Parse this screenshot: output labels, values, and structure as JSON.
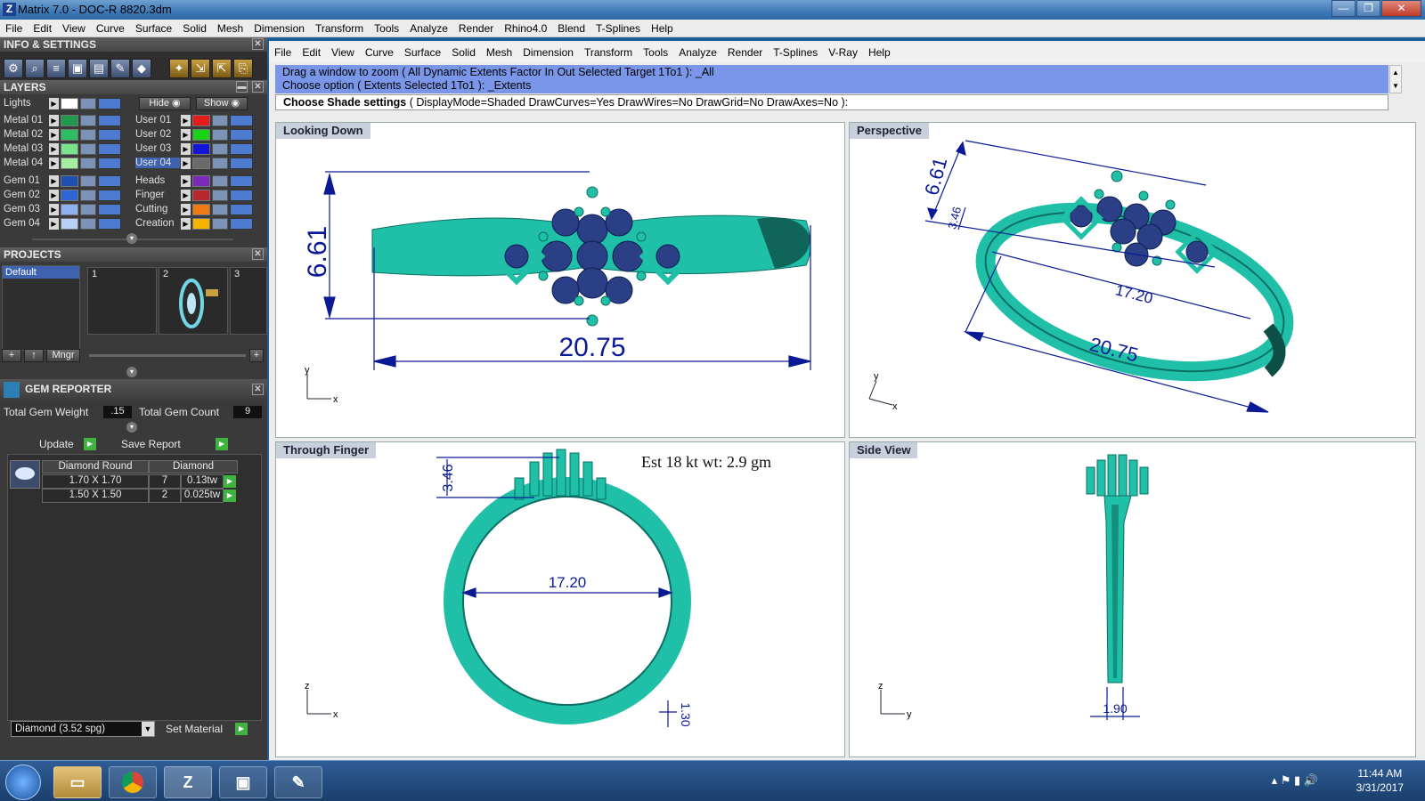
{
  "window": {
    "title": "Matrix 7.0 - DOC-R 8820.3dm",
    "controls": [
      "—",
      "❐",
      "✕"
    ]
  },
  "top_menu": [
    "File",
    "Edit",
    "View",
    "Curve",
    "Surface",
    "Solid",
    "Mesh",
    "Dimension",
    "Transform",
    "Tools",
    "Analyze",
    "Render",
    "Rhino4.0",
    "Blend",
    "T-Splines",
    "Help"
  ],
  "info_settings": {
    "title": "INFO & SETTINGS"
  },
  "layers": {
    "title": "LAYERS",
    "lights_label": "Lights",
    "hide_label": "Hide",
    "show_label": "Show",
    "left": [
      {
        "name": "Metal 01",
        "color": "#1f9a4c"
      },
      {
        "name": "Metal 02",
        "color": "#2dbd62"
      },
      {
        "name": "Metal 03",
        "color": "#79e38b"
      },
      {
        "name": "Metal 04",
        "color": "#a6ee9f"
      },
      {
        "name": "Gem 01",
        "color": "#1e4fb0"
      },
      {
        "name": "Gem 02",
        "color": "#2f66d6"
      },
      {
        "name": "Gem 03",
        "color": "#8db0ef"
      },
      {
        "name": "Gem 04",
        "color": "#b8cff6"
      }
    ],
    "right": [
      {
        "name": "User 01",
        "color": "#e61b1b"
      },
      {
        "name": "User 02",
        "color": "#19d319"
      },
      {
        "name": "User 03",
        "color": "#1414d8"
      },
      {
        "name": "User 04",
        "color": "#6a6a6a"
      },
      {
        "name": "Heads",
        "color": "#7a2ab8"
      },
      {
        "name": "Finger",
        "color": "#b8262e"
      },
      {
        "name": "Cutting",
        "color": "#f07a14"
      },
      {
        "name": "Creation",
        "color": "#f4b400"
      }
    ]
  },
  "projects": {
    "title": "PROJECTS",
    "list": [
      "Default"
    ],
    "thumb_numbers": [
      "1",
      "2",
      "3"
    ],
    "mngr": "Mngr"
  },
  "gem_reporter": {
    "title": "GEM REPORTER",
    "weight_label": "Total Gem Weight",
    "weight_value": ".15",
    "count_label": "Total Gem Count",
    "count_value": "9",
    "update": "Update",
    "save_report": "Save Report",
    "col1": "Diamond Round",
    "col2": "Diamond",
    "rows": [
      {
        "size": "1.70 X 1.70",
        "count": "7",
        "wt": "0.13tw"
      },
      {
        "size": "1.50 X 1.50",
        "count": "2",
        "wt": "0.025tw"
      }
    ],
    "material_select": "Diamond      (3.52 spg)",
    "set_material": "Set Material"
  },
  "doc_menu": [
    "File",
    "Edit",
    "View",
    "Curve",
    "Surface",
    "Solid",
    "Mesh",
    "Dimension",
    "Transform",
    "Tools",
    "Analyze",
    "Render",
    "T-Splines",
    "V-Ray",
    "Help"
  ],
  "command": {
    "line1": "Drag a window to zoom ( All  Dynamic  Extents  Factor  In  Out  Selected  Target  1To1 ): _All",
    "line2": "Choose option ( Extents  Selected  1To1 ): _Extents",
    "prompt_bold": "Choose Shade settings",
    "prompt_rest": " ( DisplayMode=Shaded  DrawCurves=Yes  DrawWires=No  DrawGrid=No  DrawAxes=No ):"
  },
  "viewports": {
    "top_left": {
      "label": "Looking Down",
      "dim_h": "6.61",
      "dim_w": "20.75",
      "axis1": "y",
      "axis2": "x"
    },
    "top_right": {
      "label": "Perspective",
      "dim_h": "6.61",
      "dim_t": "3.46",
      "dim_in": "17.20",
      "dim_w": "20.75",
      "axis1": "y",
      "axis2": "x"
    },
    "bottom_left": {
      "label": "Through Finger",
      "dim_h": "3.46",
      "dim_d": "17.20",
      "dim_b": "1.30",
      "note": "Est 18 kt wt: 2.9 gm",
      "axis1": "z",
      "axis2": "x"
    },
    "bottom_right": {
      "label": "Side View",
      "dim_w": "1.90",
      "axis1": "z",
      "axis2": "y"
    }
  },
  "colors": {
    "metal": "#1fbfa8",
    "metal_dark": "#0c6f63",
    "gem": "#2b3f86",
    "dim": "#0a1a96",
    "cmd_bg": "#7a96e8"
  },
  "taskbar": {
    "start_icon": "windows-start-icon",
    "apps": [
      "folder-icon",
      "chrome-icon",
      "matrix-icon",
      "window-icon",
      "paint-icon"
    ],
    "time": "11:44 AM",
    "date": "3/31/2017"
  }
}
